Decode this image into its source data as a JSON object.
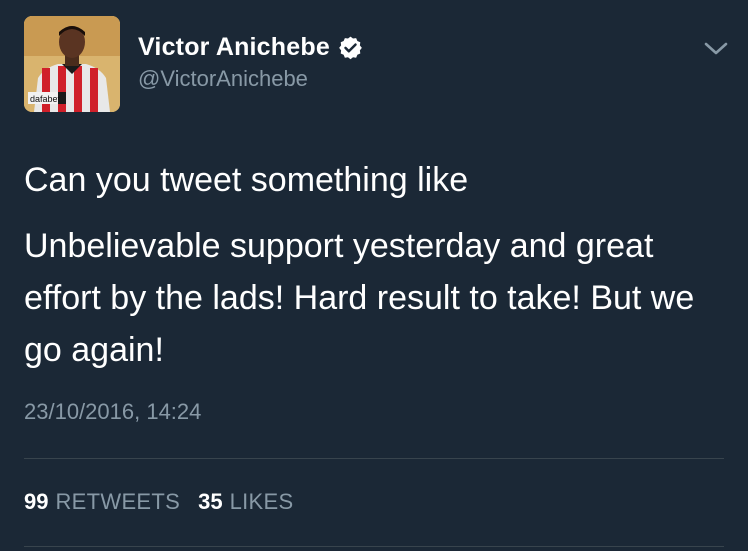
{
  "author": {
    "display_name": "Victor Anichebe",
    "handle": "@VictorAnichebe",
    "verified": true,
    "avatar_sponsor_text": "dafabet"
  },
  "tweet": {
    "lines": [
      "Can you tweet something like",
      "Unbelievable support yesterday and great effort by the lads! Hard result to take! But we go again!"
    ],
    "timestamp": "23/10/2016, 14:24"
  },
  "stats": {
    "retweets_count": "99",
    "retweets_label": "RETWEETS",
    "likes_count": "35",
    "likes_label": "LIKES"
  },
  "colors": {
    "background": "#1b2836",
    "secondary_text": "#8899a6",
    "divider": "#38444d"
  }
}
